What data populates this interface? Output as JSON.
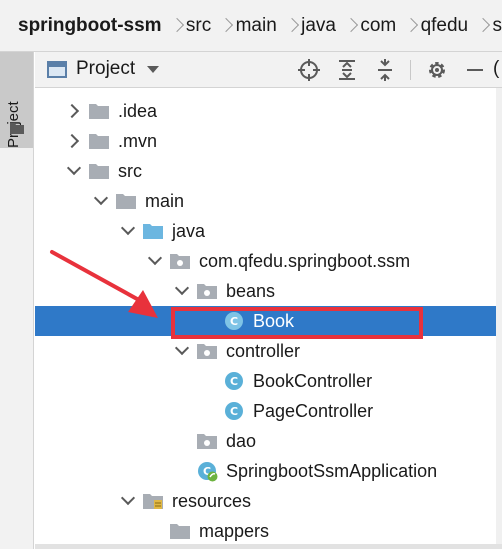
{
  "breadcrumb": [
    "springboot-ssm",
    "src",
    "main",
    "java",
    "com",
    "qfedu",
    "s"
  ],
  "sidebar": {
    "tab_label": "Project"
  },
  "toolbar": {
    "title": "Project",
    "extra": "("
  },
  "tree": [
    {
      "label": ".idea",
      "depth": 0,
      "expand": "right",
      "icon": "folder"
    },
    {
      "label": ".mvn",
      "depth": 0,
      "expand": "right",
      "icon": "folder"
    },
    {
      "label": "src",
      "depth": 0,
      "expand": "down",
      "icon": "folder"
    },
    {
      "label": "main",
      "depth": 1,
      "expand": "down",
      "icon": "folder"
    },
    {
      "label": "java",
      "depth": 2,
      "expand": "down",
      "icon": "source-folder"
    },
    {
      "label": "com.qfedu.springboot.ssm",
      "depth": 3,
      "expand": "down",
      "icon": "package"
    },
    {
      "label": "beans",
      "depth": 4,
      "expand": "down",
      "icon": "package"
    },
    {
      "label": "Book",
      "depth": 5,
      "expand": "none",
      "icon": "class",
      "selected": true
    },
    {
      "label": "controller",
      "depth": 4,
      "expand": "down",
      "icon": "package"
    },
    {
      "label": "BookController",
      "depth": 5,
      "expand": "none",
      "icon": "class"
    },
    {
      "label": "PageController",
      "depth": 5,
      "expand": "none",
      "icon": "class"
    },
    {
      "label": "dao",
      "depth": 4,
      "expand": "none",
      "icon": "package"
    },
    {
      "label": "SpringbootSsmApplication",
      "depth": 4,
      "expand": "none",
      "icon": "spring-class"
    },
    {
      "label": "resources",
      "depth": 2,
      "expand": "down",
      "icon": "resources-folder"
    },
    {
      "label": "mappers",
      "depth": 3,
      "expand": "none",
      "icon": "folder"
    }
  ],
  "colors": {
    "selection": "#2f79c8",
    "highlight_box": "#e8323c",
    "annotation_arrow": "#e8323c",
    "folder": "#a8adb4",
    "source_folder": "#6cb6e0",
    "class_icon": "#5ab0d8"
  }
}
